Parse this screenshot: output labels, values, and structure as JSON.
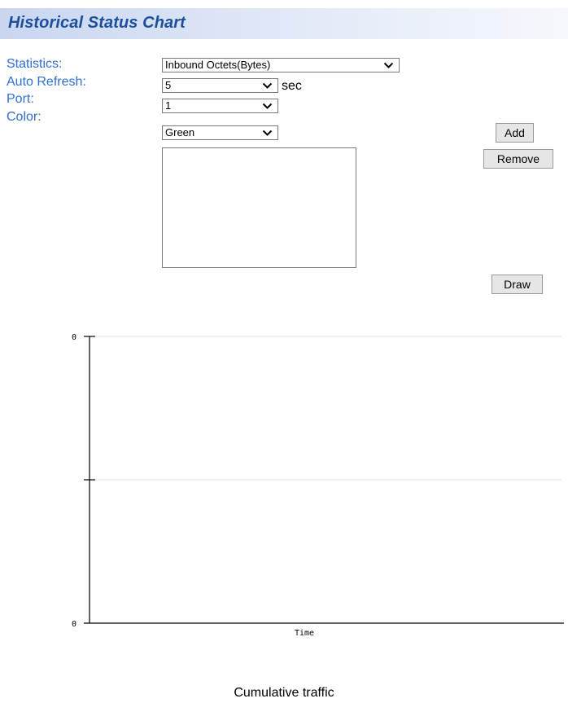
{
  "header": {
    "title": "Historical Status Chart"
  },
  "form": {
    "statistics": {
      "label": "Statistics:",
      "value": "Inbound Octets(Bytes)"
    },
    "auto_refresh": {
      "label": "Auto Refresh:",
      "value": "5",
      "unit": "sec"
    },
    "port": {
      "label": "Port:",
      "value": "1"
    },
    "color": {
      "label": "Color:",
      "value": "Green"
    }
  },
  "buttons": {
    "add": "Add",
    "remove": "Remove",
    "draw": "Draw"
  },
  "chart_data": {
    "type": "line",
    "series": [],
    "y_tick_labels": [
      "0",
      "0"
    ],
    "xlabel": "Time",
    "caption": "Cumulative traffic",
    "grid": true,
    "ylim": [
      0,
      0
    ]
  }
}
